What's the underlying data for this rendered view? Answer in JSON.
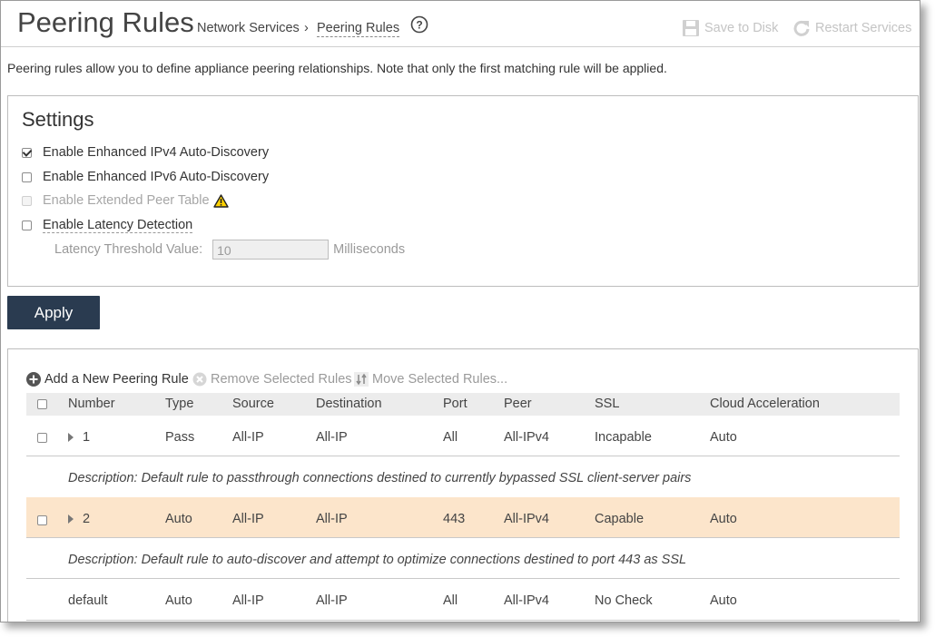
{
  "header": {
    "title": "Peering Rules",
    "breadcrumb": [
      "Network Services",
      "Peering Rules"
    ],
    "breadcrumb_separator": "›",
    "save_label": "Save to Disk",
    "restart_label": "Restart Services"
  },
  "intro": "Peering rules allow you to define appliance peering relationships. Note that only the first matching rule will be applied.",
  "settings": {
    "title": "Settings",
    "options": [
      {
        "label": "Enable Enhanced IPv4 Auto-Discovery",
        "checked": true,
        "disabled": false
      },
      {
        "label": "Enable Enhanced IPv6 Auto-Discovery",
        "checked": false,
        "disabled": false
      },
      {
        "label": "Enable Extended Peer Table",
        "checked": false,
        "disabled": true,
        "icon": "warning-icon"
      },
      {
        "label": "Enable Latency Detection",
        "checked": false,
        "disabled": false
      }
    ],
    "latency_label": "Latency Threshold Value:",
    "latency_value": "10",
    "latency_unit": "Milliseconds"
  },
  "apply_label": "Apply",
  "toolbar": {
    "add_label": "Add a New Peering Rule",
    "remove_label": "Remove Selected Rules",
    "move_label": "Move Selected Rules..."
  },
  "table": {
    "columns": [
      "Number",
      "Type",
      "Source",
      "Destination",
      "Port",
      "Peer",
      "SSL",
      "Cloud Acceleration"
    ],
    "rows": [
      {
        "number": "1",
        "type": "Pass",
        "source": "All-IP",
        "destination": "All-IP",
        "port": "All",
        "peer": "All-IPv4",
        "ssl": "Incapable",
        "cloud": "Auto",
        "description": "Description: Default rule to passthrough connections destined to currently bypassed SSL client-server pairs"
      },
      {
        "number": "2",
        "type": "Auto",
        "source": "All-IP",
        "destination": "All-IP",
        "port": "443",
        "peer": "All-IPv4",
        "ssl": "Capable",
        "cloud": "Auto",
        "description": "Description: Default rule to auto-discover and attempt to optimize connections destined to port 443 as SSL"
      },
      {
        "number": "default",
        "type": "Auto",
        "source": "All-IP",
        "destination": "All-IP",
        "port": "All",
        "peer": "All-IPv4",
        "ssl": "No Check",
        "cloud": "Auto"
      }
    ]
  },
  "colors": {
    "apply_bg": "#2a3b50",
    "highlight_row": "#fce5cb",
    "header_row": "#ececec"
  }
}
